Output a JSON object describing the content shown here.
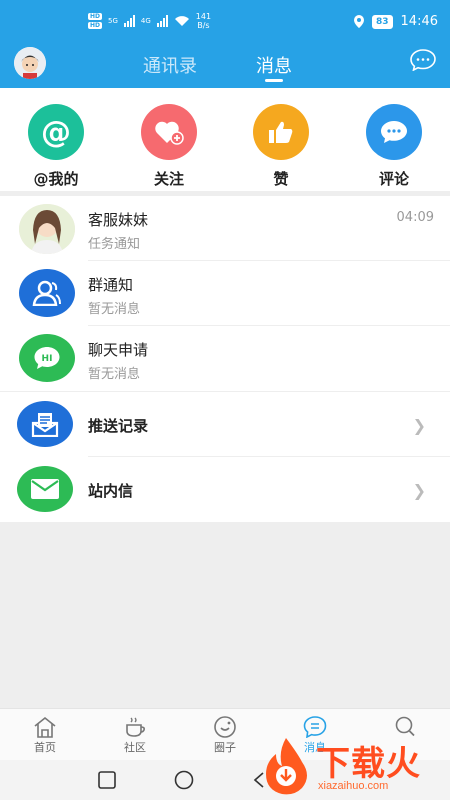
{
  "status_bar": {
    "hd_labels": [
      "HD",
      "HD"
    ],
    "signal_label": "5G",
    "signal_label_2": "4G",
    "speed_value": "141",
    "speed_unit": "B/s",
    "battery": "83",
    "time": "14:46"
  },
  "header": {
    "tabs": [
      {
        "label": "通讯录",
        "active": false
      },
      {
        "label": "消息",
        "active": true
      }
    ]
  },
  "quick_actions": [
    {
      "label": "@我的",
      "icon": "at-icon",
      "color": "#1cc09a"
    },
    {
      "label": "关注",
      "icon": "heart-plus-icon",
      "color": "#f66a6f"
    },
    {
      "label": "赞",
      "icon": "thumbs-up-icon",
      "color": "#f5a81f"
    },
    {
      "label": "评论",
      "icon": "comment-icon",
      "color": "#2c97ea"
    }
  ],
  "messages": [
    {
      "title": "客服妹妹",
      "subtitle": "任务通知",
      "time": "04:09",
      "icon": "service-avatar"
    },
    {
      "title": "群通知",
      "subtitle": "暂无消息",
      "icon": "group-icon",
      "color": "#1f6fd8"
    },
    {
      "title": "聊天申请",
      "subtitle": "暂无消息",
      "icon": "hi-chat-icon",
      "color": "#2dbb55"
    }
  ],
  "links": [
    {
      "title": "推送记录",
      "icon": "push-record-icon",
      "color": "#1f6fd8"
    },
    {
      "title": "站内信",
      "icon": "mail-icon",
      "color": "#2dbb55"
    }
  ],
  "bottom_nav": [
    {
      "label": "首页",
      "icon": "home-icon",
      "active": false
    },
    {
      "label": "社区",
      "icon": "coffee-icon",
      "active": false
    },
    {
      "label": "圈子",
      "icon": "circle-smile-icon",
      "active": false
    },
    {
      "label": "消息",
      "icon": "message-icon",
      "active": true
    },
    {
      "label": "",
      "icon": "search-icon",
      "active": false
    }
  ],
  "watermark": {
    "brand": "下载火",
    "url": "xiazaihuo.com"
  },
  "colors": {
    "accent": "#27a2e6",
    "background": "#eeeeee"
  }
}
